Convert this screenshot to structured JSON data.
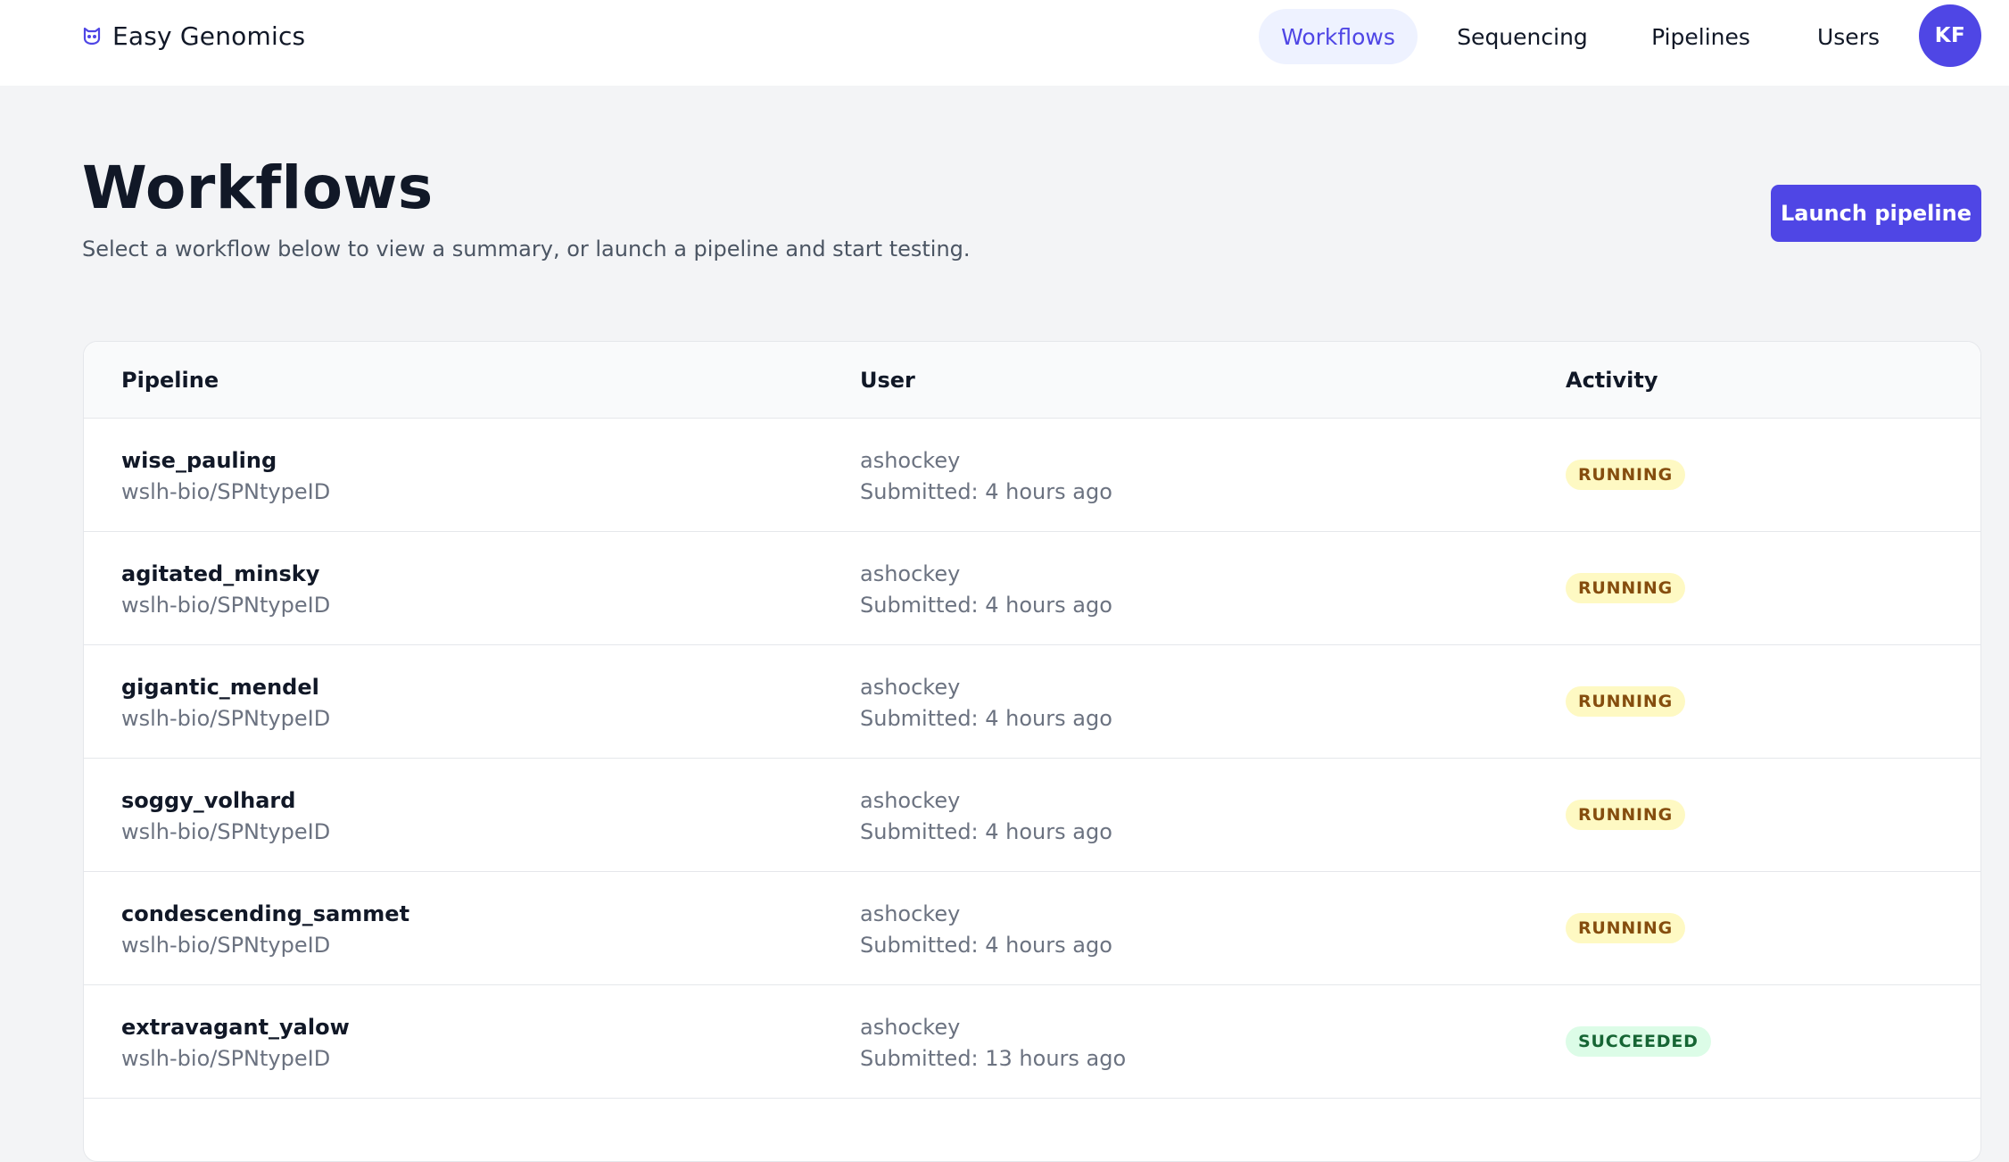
{
  "brand": {
    "name": "Easy Genomics",
    "icon": "owl-icon"
  },
  "nav": {
    "items": [
      {
        "label": "Workflows",
        "active": true
      },
      {
        "label": "Sequencing",
        "active": false
      },
      {
        "label": "Pipelines",
        "active": false
      },
      {
        "label": "Users",
        "active": false
      }
    ],
    "avatar_initials": "KF"
  },
  "page": {
    "title": "Workflows",
    "subtitle": "Select a workflow below to view a summary, or launch a pipeline and start testing.",
    "launch_button": "Launch pipeline"
  },
  "table": {
    "columns": [
      "Pipeline",
      "User",
      "Activity"
    ],
    "rows": [
      {
        "run_name": "wise_pauling",
        "pipeline": "wslh-bio/SPNtypeID",
        "user": "ashockey",
        "submitted": "Submitted: 4 hours ago",
        "status": "RUNNING"
      },
      {
        "run_name": "agitated_minsky",
        "pipeline": "wslh-bio/SPNtypeID",
        "user": "ashockey",
        "submitted": "Submitted: 4 hours ago",
        "status": "RUNNING"
      },
      {
        "run_name": "gigantic_mendel",
        "pipeline": "wslh-bio/SPNtypeID",
        "user": "ashockey",
        "submitted": "Submitted: 4 hours ago",
        "status": "RUNNING"
      },
      {
        "run_name": "soggy_volhard",
        "pipeline": "wslh-bio/SPNtypeID",
        "user": "ashockey",
        "submitted": "Submitted: 4 hours ago",
        "status": "RUNNING"
      },
      {
        "run_name": "condescending_sammet",
        "pipeline": "wslh-bio/SPNtypeID",
        "user": "ashockey",
        "submitted": "Submitted: 4 hours ago",
        "status": "RUNNING"
      },
      {
        "run_name": "extravagant_yalow",
        "pipeline": "wslh-bio/SPNtypeID",
        "user": "ashockey",
        "submitted": "Submitted: 13 hours ago",
        "status": "SUCCEEDED"
      }
    ]
  },
  "colors": {
    "accent": "#4f46e5",
    "nav_active_bg": "#eef2ff",
    "running_bg": "#fef9c3",
    "running_text": "#854d0e",
    "succeeded_bg": "#dcfce7",
    "succeeded_text": "#166534"
  }
}
